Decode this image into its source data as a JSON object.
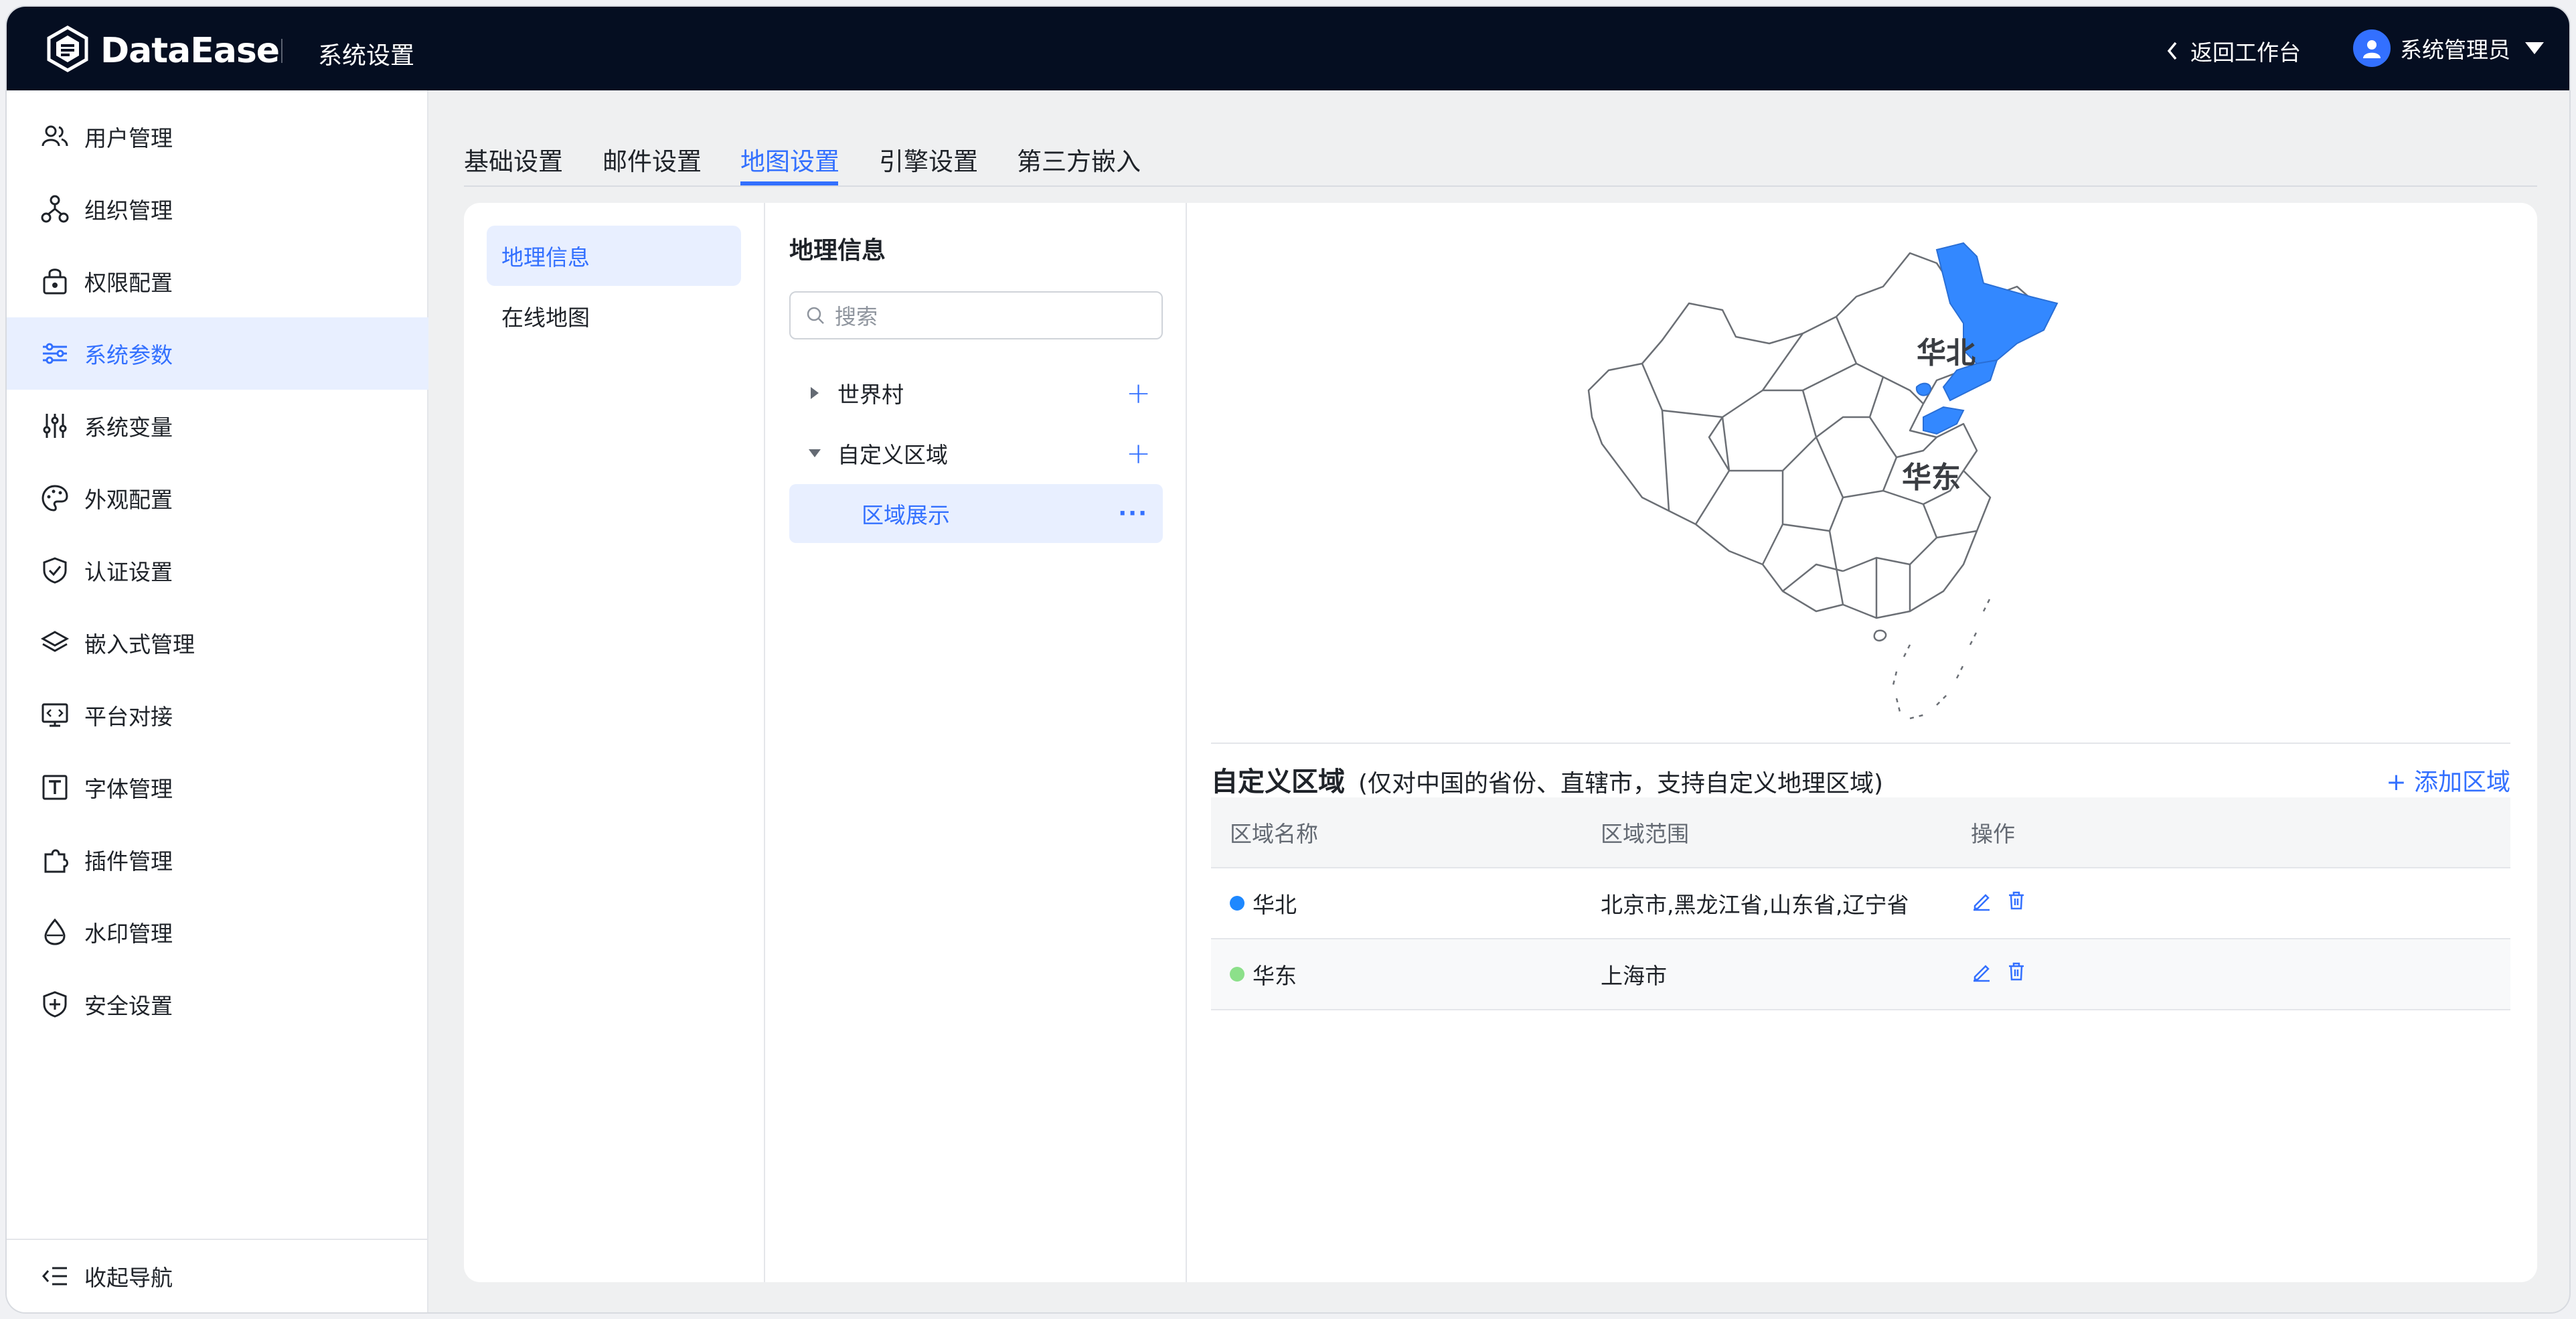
{
  "header": {
    "brand": "DataEase",
    "title": "系统设置",
    "back_label": "返回工作台",
    "user_name": "系统管理员"
  },
  "sidebar": {
    "items": [
      {
        "label": "用户管理",
        "icon": "users-icon"
      },
      {
        "label": "组织管理",
        "icon": "org-icon"
      },
      {
        "label": "权限配置",
        "icon": "lock-icon"
      },
      {
        "label": "系统参数",
        "icon": "sliders-icon",
        "active": true
      },
      {
        "label": "系统变量",
        "icon": "variables-icon"
      },
      {
        "label": "外观配置",
        "icon": "palette-icon"
      },
      {
        "label": "认证设置",
        "icon": "shield-check-icon"
      },
      {
        "label": "嵌入式管理",
        "icon": "layers-icon"
      },
      {
        "label": "平台对接",
        "icon": "monitor-code-icon"
      },
      {
        "label": "字体管理",
        "icon": "font-icon"
      },
      {
        "label": "插件管理",
        "icon": "plugin-icon"
      },
      {
        "label": "水印管理",
        "icon": "watermark-icon"
      },
      {
        "label": "安全设置",
        "icon": "shield-plus-icon"
      }
    ],
    "collapse_label": "收起导航"
  },
  "tabs": [
    "基础设置",
    "邮件设置",
    "地图设置",
    "引擎设置",
    "第三方嵌入"
  ],
  "active_tab": "地图设置",
  "submenu": {
    "items": [
      "地理信息",
      "在线地图"
    ],
    "active": "地理信息"
  },
  "geo_panel": {
    "title": "地理信息",
    "search_placeholder": "搜索",
    "tree": [
      {
        "label": "世界村",
        "expanded": false
      },
      {
        "label": "自定义区域",
        "expanded": true,
        "children": [
          "区域展示"
        ]
      }
    ]
  },
  "map": {
    "labels": [
      "华北",
      "华东"
    ],
    "highlight_color": "#3388ff"
  },
  "custom_region": {
    "title": "自定义区域",
    "note": "(仅对中国的省份、直辖市，支持自定义地理区域)",
    "add_label": "+ 添加区域",
    "columns": [
      "区域名称",
      "区域范围",
      "操作"
    ],
    "rows": [
      {
        "name": "华北",
        "color": "#1e88ff",
        "scope": "北京市,黑龙江省,山东省,辽宁省"
      },
      {
        "name": "华东",
        "color": "#8ce08a",
        "scope": "上海市"
      }
    ]
  }
}
